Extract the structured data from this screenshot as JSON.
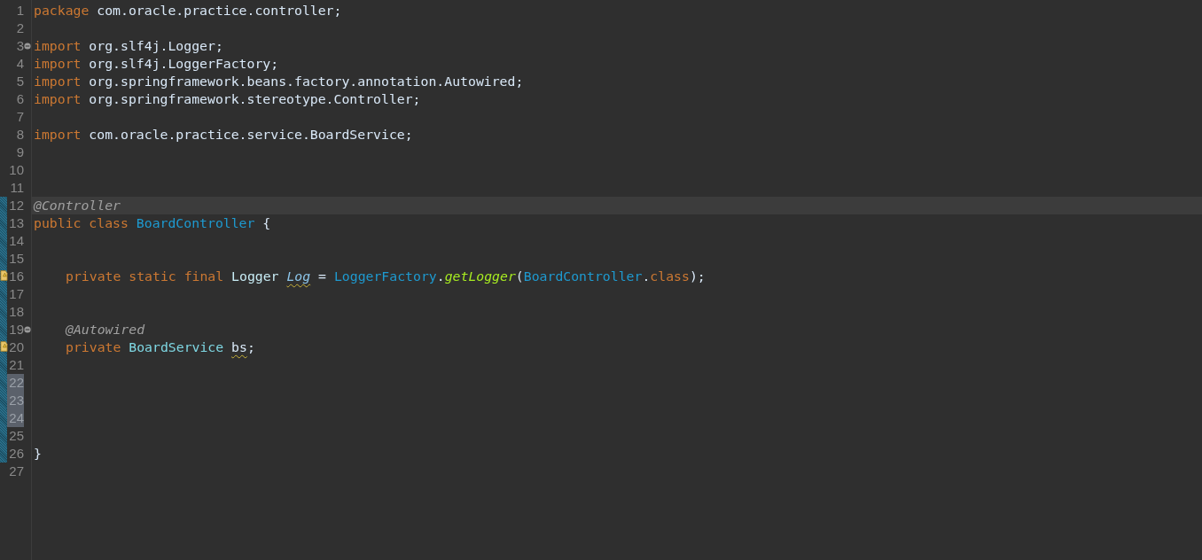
{
  "editor": {
    "lines": [
      {
        "number": "1",
        "fold": false,
        "warning": false,
        "changed": false,
        "selected": false,
        "current": false,
        "indented": false,
        "tokens": [
          {
            "text": "package",
            "kind": "keyword"
          },
          {
            "text": " com.oracle.practice.controller;",
            "kind": "plain"
          }
        ]
      },
      {
        "number": "2",
        "fold": false,
        "warning": false,
        "changed": false,
        "selected": false,
        "current": false
      },
      {
        "number": "3",
        "fold": true,
        "warning": false,
        "changed": false,
        "selected": false,
        "current": false,
        "indented": false,
        "tokens": [
          {
            "text": "import",
            "kind": "keyword"
          },
          {
            "text": " org.slf4j.Logger;",
            "kind": "plain"
          }
        ]
      },
      {
        "number": "4",
        "fold": false,
        "warning": false,
        "changed": false,
        "selected": false,
        "current": false,
        "indented": false,
        "tokens": [
          {
            "text": "import",
            "kind": "keyword"
          },
          {
            "text": " org.slf4j.LoggerFactory;",
            "kind": "plain"
          }
        ]
      },
      {
        "number": "5",
        "fold": false,
        "warning": false,
        "changed": false,
        "selected": false,
        "current": false,
        "indented": false,
        "tokens": [
          {
            "text": "import",
            "kind": "keyword"
          },
          {
            "text": " org.springframework.beans.factory.annotation.Autowired;",
            "kind": "plain"
          }
        ]
      },
      {
        "number": "6",
        "fold": false,
        "warning": false,
        "changed": false,
        "selected": false,
        "current": false,
        "indented": false,
        "tokens": [
          {
            "text": "import",
            "kind": "keyword"
          },
          {
            "text": " org.springframework.stereotype.Controller;",
            "kind": "plain"
          }
        ]
      },
      {
        "number": "7",
        "fold": false,
        "warning": false,
        "changed": false,
        "selected": false,
        "current": false
      },
      {
        "number": "8",
        "fold": false,
        "warning": false,
        "changed": false,
        "selected": false,
        "current": false,
        "indented": false,
        "tokens": [
          {
            "text": "import",
            "kind": "keyword"
          },
          {
            "text": " com.oracle.practice.service.BoardService;",
            "kind": "plain"
          }
        ]
      },
      {
        "number": "9",
        "fold": false,
        "warning": false,
        "changed": false,
        "selected": false,
        "current": false
      },
      {
        "number": "10",
        "fold": false,
        "warning": false,
        "changed": false,
        "selected": false,
        "current": false
      },
      {
        "number": "11",
        "fold": false,
        "warning": false,
        "changed": false,
        "selected": false,
        "current": false
      },
      {
        "number": "12",
        "fold": false,
        "warning": false,
        "changed": true,
        "selected": false,
        "current": true,
        "indented": false,
        "tokens": [
          {
            "text": "@Controller",
            "kind": "annotation"
          }
        ]
      },
      {
        "number": "13",
        "fold": false,
        "warning": false,
        "changed": true,
        "selected": false,
        "current": false,
        "indented": false,
        "tokens": [
          {
            "text": "public class",
            "kind": "keyword"
          },
          {
            "text": " BoardController",
            "kind": "class"
          },
          {
            "text": " {",
            "kind": "plain"
          }
        ]
      },
      {
        "number": "14",
        "fold": false,
        "warning": false,
        "changed": true,
        "selected": false,
        "current": false
      },
      {
        "number": "15",
        "fold": false,
        "warning": false,
        "changed": true,
        "selected": false,
        "current": false
      },
      {
        "number": "16",
        "fold": false,
        "warning": true,
        "changed": true,
        "selected": false,
        "current": false,
        "indented": true,
        "tokens": [
          {
            "text": "private static final",
            "kind": "keyword"
          },
          {
            "text": " Logger ",
            "kind": "type"
          },
          {
            "text": "Log",
            "kind": "static-field-warn"
          },
          {
            "text": " = ",
            "kind": "plain"
          },
          {
            "text": "LoggerFactory",
            "kind": "class"
          },
          {
            "text": ".",
            "kind": "plain"
          },
          {
            "text": "getLogger",
            "kind": "method"
          },
          {
            "text": "(",
            "kind": "plain"
          },
          {
            "text": "BoardController",
            "kind": "class"
          },
          {
            "text": ".",
            "kind": "plain"
          },
          {
            "text": "class",
            "kind": "keyword"
          },
          {
            "text": ");",
            "kind": "plain"
          }
        ]
      },
      {
        "number": "17",
        "fold": false,
        "warning": false,
        "changed": true,
        "selected": false,
        "current": false
      },
      {
        "number": "18",
        "fold": false,
        "warning": false,
        "changed": true,
        "selected": false,
        "current": false
      },
      {
        "number": "19",
        "fold": true,
        "warning": false,
        "changed": true,
        "selected": false,
        "current": false,
        "indented": true,
        "tokens": [
          {
            "text": "@Autowired",
            "kind": "annotation"
          }
        ]
      },
      {
        "number": "20",
        "fold": false,
        "warning": true,
        "changed": true,
        "selected": false,
        "current": false,
        "indented": true,
        "tokens": [
          {
            "text": "private",
            "kind": "keyword"
          },
          {
            "text": " BoardService ",
            "kind": "field-type"
          },
          {
            "text": "bs",
            "kind": "field-warn"
          },
          {
            "text": ";",
            "kind": "plain"
          }
        ]
      },
      {
        "number": "21",
        "fold": false,
        "warning": false,
        "changed": true,
        "selected": false,
        "current": false
      },
      {
        "number": "22",
        "fold": false,
        "warning": false,
        "changed": true,
        "selected": true,
        "current": false
      },
      {
        "number": "23",
        "fold": false,
        "warning": false,
        "changed": true,
        "selected": true,
        "current": false
      },
      {
        "number": "24",
        "fold": false,
        "warning": false,
        "changed": true,
        "selected": true,
        "current": false
      },
      {
        "number": "25",
        "fold": false,
        "warning": false,
        "changed": true,
        "selected": false,
        "current": false
      },
      {
        "number": "26",
        "fold": false,
        "warning": false,
        "changed": true,
        "selected": false,
        "current": false,
        "indented": false,
        "tokens": [
          {
            "text": "}",
            "kind": "plain"
          }
        ]
      },
      {
        "number": "27",
        "fold": false,
        "warning": false,
        "changed": false,
        "selected": false,
        "current": false
      }
    ]
  }
}
